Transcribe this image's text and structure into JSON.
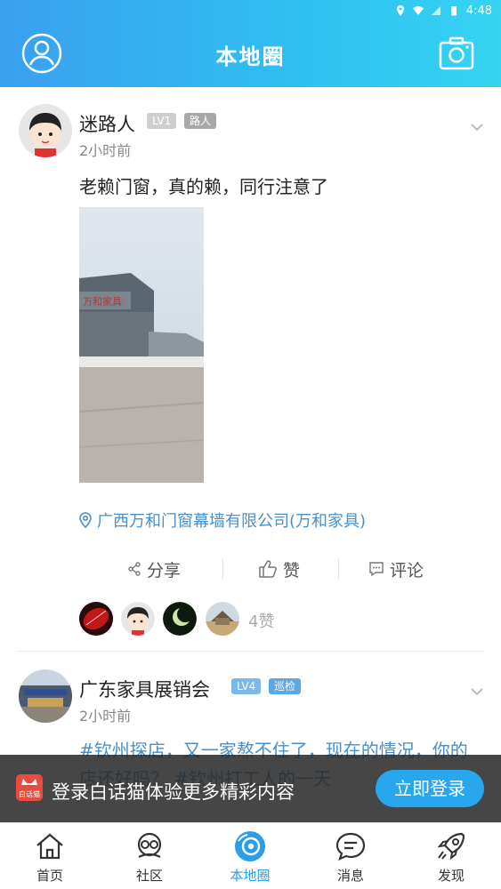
{
  "status_bar": {
    "time": "4:48"
  },
  "header": {
    "title": "本地圈",
    "profile_icon": "user-circle-icon",
    "camera_icon": "camera-icon"
  },
  "posts": [
    {
      "username": "迷路人",
      "level": "LV1",
      "role": "路人",
      "time": "2小时前",
      "content": "老赖门窗，真的赖，同行注意了",
      "location": "广西万和门窗幕墙有限公司(万和家具)",
      "actions": {
        "share": "分享",
        "like": "赞",
        "comment": "评论"
      },
      "like_count": "4赞"
    },
    {
      "username": "广东家具展销会",
      "level": "LV4",
      "role": "巡检",
      "time": "2小时前",
      "content": "#钦州探店，又一家熬不住了，现在的情况，你的店还好吗？ #钦州打工人的一天"
    }
  ],
  "login_banner": {
    "text": "登录白话猫体验更多精彩内容",
    "button": "立即登录",
    "logo_text": "白话猫"
  },
  "tabbar": {
    "items": [
      {
        "label": "首页",
        "icon": "home-icon"
      },
      {
        "label": "社区",
        "icon": "community-icon"
      },
      {
        "label": "本地圈",
        "icon": "local-circle-icon",
        "active": true
      },
      {
        "label": "消息",
        "icon": "message-icon"
      },
      {
        "label": "发现",
        "icon": "rocket-icon"
      }
    ]
  },
  "colors": {
    "accent": "#2a9ee8",
    "header_start": "#3aa0f0",
    "header_end": "#36d3f2",
    "level_badge": "#7eb8ea",
    "role_badge": "#a8a8a8"
  }
}
